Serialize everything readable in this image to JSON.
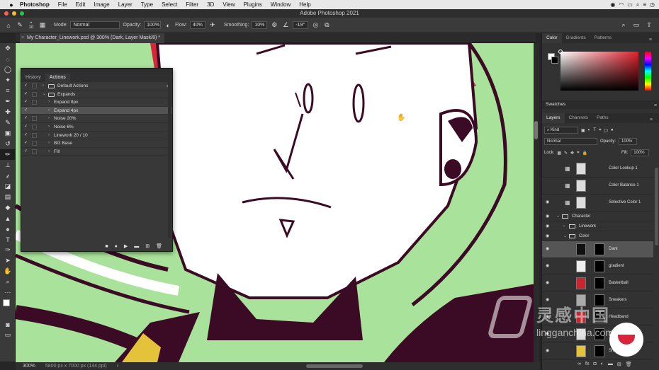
{
  "menubar": {
    "app_name": "Photoshop",
    "menus": [
      "File",
      "Edit",
      "Image",
      "Layer",
      "Type",
      "Select",
      "Filter",
      "3D",
      "View",
      "Plugins",
      "Window",
      "Help"
    ],
    "clock": "◷"
  },
  "window": {
    "title": "Adobe Photoshop 2021"
  },
  "options": {
    "brush_size": "10",
    "mode_label": "Mode:",
    "mode_value": "Normal",
    "opacity_label": "Opacity:",
    "opacity_value": "100%",
    "flow_label": "Flow:",
    "flow_value": "40%",
    "smoothing_label": "Smoothing:",
    "smoothing_value": "10%",
    "angle_value": "-19°"
  },
  "document": {
    "tab_title": "My Character_Linework.psd @ 300% (Dark, Layer Mask/8) *",
    "zoom": "300%",
    "doc_size": "5800 px x 7000 px (144 ppi)"
  },
  "actions_panel": {
    "tabs": [
      "History",
      "Actions"
    ],
    "active_tab": "Actions",
    "rows": [
      {
        "label": "Default Actions",
        "type": "set",
        "indent": 0,
        "expanded": false
      },
      {
        "label": "Expands",
        "type": "set",
        "indent": 0,
        "expanded": true
      },
      {
        "label": "Expand 8px",
        "type": "action",
        "indent": 1
      },
      {
        "label": "Expand 4px",
        "type": "action",
        "indent": 1,
        "selected": true
      },
      {
        "label": "Noise 20%",
        "type": "action",
        "indent": 1
      },
      {
        "label": "Noise 6%",
        "type": "action",
        "indent": 1
      },
      {
        "label": "Linework 20 / 10",
        "type": "action",
        "indent": 1
      },
      {
        "label": "BG Base",
        "type": "action",
        "indent": 1
      },
      {
        "label": "Fill",
        "type": "action",
        "indent": 1
      }
    ]
  },
  "right_panels": {
    "color_tabs": [
      "Color",
      "Gradients",
      "Patterns"
    ],
    "swatches_label": "Swatches",
    "layer_tabs": [
      "Layers",
      "Channels",
      "Paths"
    ],
    "kind_label": "Kind",
    "blend_mode": "Normal",
    "opacity_label": "Opacity:",
    "opacity_value": "100%",
    "lock_label": "Lock:",
    "fill_label": "Fill:",
    "fill_value": "100%",
    "layers": [
      {
        "name": "Color Lookup 1",
        "kind": "adjust",
        "thumb": "#ddd"
      },
      {
        "name": "Color Balance 1",
        "kind": "adjust",
        "thumb": "#ddd"
      },
      {
        "name": "Selective Color 1",
        "kind": "adjust",
        "thumb": "#ddd"
      },
      {
        "name": "Character",
        "kind": "group",
        "indent": 0
      },
      {
        "name": "Linework",
        "kind": "group",
        "indent": 1
      },
      {
        "name": "Color",
        "kind": "group-open",
        "indent": 1
      },
      {
        "name": "Dark",
        "kind": "pixel",
        "thumb": "#111",
        "selected": true
      },
      {
        "name": "gradient",
        "kind": "pixel",
        "thumb": "#eee"
      },
      {
        "name": "Basketball",
        "kind": "pixel",
        "thumb": "#c8252f"
      },
      {
        "name": "Sneakers",
        "kind": "pixel",
        "thumb": "#aaa"
      },
      {
        "name": "Headband",
        "kind": "pixel",
        "thumb": "#c8252f"
      },
      {
        "name": "Socks",
        "kind": "pixel",
        "thumb": "#ddd"
      },
      {
        "name": "Shirt",
        "kind": "pixel",
        "thumb": "#e4c23a"
      }
    ]
  },
  "watermark": {
    "text": "lingganchina.com"
  },
  "colors": {
    "canvas_green": "#a9e39b",
    "ink": "#3b0a24",
    "hair_red": "#d9243a",
    "accent_yellow": "#e4c23a"
  }
}
